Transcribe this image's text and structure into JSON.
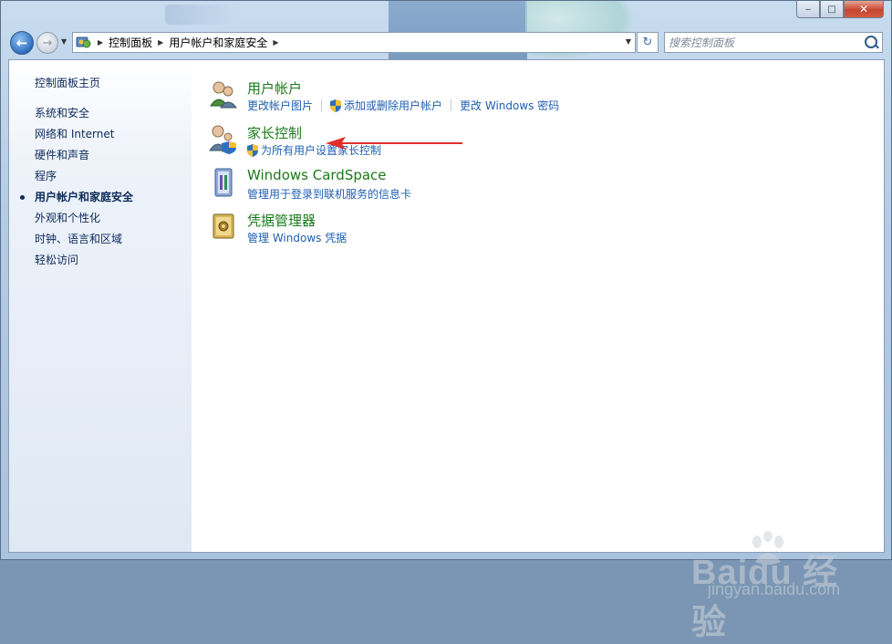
{
  "window": {
    "caption_buttons": {
      "minimize": "‒",
      "maximize": "□",
      "close": "✕"
    }
  },
  "nav": {
    "back_icon": "arrow-left-icon",
    "forward_icon": "arrow-right-icon"
  },
  "address_bar": {
    "breadcrumbs": [
      "控制面板",
      "用户帐户和家庭安全"
    ]
  },
  "search": {
    "placeholder": "搜索控制面板"
  },
  "sidebar": {
    "items": [
      {
        "label": "控制面板主页"
      },
      {
        "label": "系统和安全"
      },
      {
        "label": "网络和 Internet"
      },
      {
        "label": "硬件和声音"
      },
      {
        "label": "程序"
      },
      {
        "label": "用户帐户和家庭安全",
        "active": true
      },
      {
        "label": "外观和个性化"
      },
      {
        "label": "时钟、语言和区域"
      },
      {
        "label": "轻松访问"
      }
    ]
  },
  "categories": [
    {
      "title": "用户帐户",
      "icon": "users-icon",
      "links": [
        "更改帐户图片",
        "添加或删除用户帐户",
        "更改 Windows 密码"
      ]
    },
    {
      "title": "家长控制",
      "icon": "parental-controls-icon",
      "links": [
        "为所有用户设置家长控制"
      ]
    },
    {
      "title": "Windows CardSpace",
      "icon": "cardspace-icon",
      "links": [
        "管理用于登录到联机服务的信息卡"
      ]
    },
    {
      "title": "凭据管理器",
      "icon": "credential-manager-icon",
      "links": [
        "管理 Windows 凭据"
      ]
    }
  ],
  "watermark": {
    "logo": "Baidu 经验",
    "url": "jingyan.baidu.com"
  },
  "colors": {
    "link": "#1e5fb1",
    "category_title": "#1a7a1a",
    "arrow": "#e0302a"
  }
}
